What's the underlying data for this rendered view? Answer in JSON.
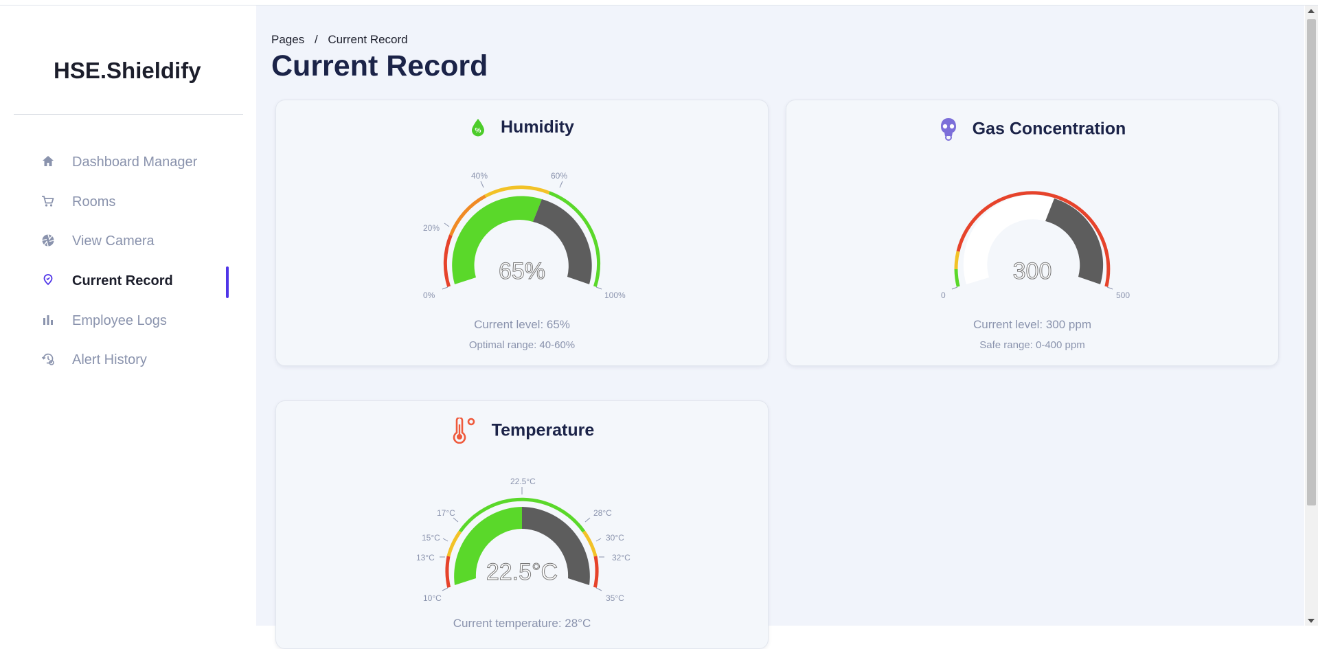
{
  "brand": "HSE.Shieldify",
  "sidebar": {
    "items": [
      {
        "label": "Dashboard Manager",
        "icon": "home-icon"
      },
      {
        "label": "Rooms",
        "icon": "cart-icon"
      },
      {
        "label": "View Camera",
        "icon": "aperture-icon"
      },
      {
        "label": "Current Record",
        "icon": "location-pin-icon",
        "active": true
      },
      {
        "label": "Employee Logs",
        "icon": "bar-chart-icon"
      },
      {
        "label": "Alert History",
        "icon": "history-gear-icon"
      }
    ]
  },
  "breadcrumb": {
    "root": "Pages",
    "separator": "/",
    "current": "Current Record"
  },
  "page_title": "Current Record",
  "cards": {
    "humidity": {
      "title": "Humidity",
      "icon": "humidity-drop-icon",
      "value_label": "65%",
      "value": 65,
      "min": 0,
      "max": 100,
      "ticks": [
        "0%",
        "20%",
        "40%",
        "60%",
        "100%"
      ],
      "level_text": "Current level: 65%",
      "range_text": "Optimal range: 40-60%"
    },
    "gas": {
      "title": "Gas Concentration",
      "icon": "gas-mask-icon",
      "value_label": "300",
      "value": 300,
      "min": 0,
      "max": 500,
      "ticks": [
        "0",
        "500"
      ],
      "level_text": "Current level: 300 ppm",
      "range_text": "Safe range: 0-400 ppm"
    },
    "temperature": {
      "title": "Temperature",
      "icon": "thermometer-icon",
      "value_label": "22.5°C",
      "value": 22.5,
      "min": 10,
      "max": 35,
      "ticks": [
        "10°C",
        "13°C",
        "15°C",
        "17°C",
        "22.5°C",
        "28°C",
        "30°C",
        "32°C",
        "35°C"
      ],
      "level_text": "Current temperature: 28°C"
    }
  },
  "colors": {
    "accent": "#4f35e8",
    "green": "#5ad82a",
    "yellow": "#f2c227",
    "orange": "#f08a24",
    "red": "#e6432b",
    "dark": "#5d5d5d",
    "title": "#1b2348",
    "muted": "#8a93ad"
  }
}
